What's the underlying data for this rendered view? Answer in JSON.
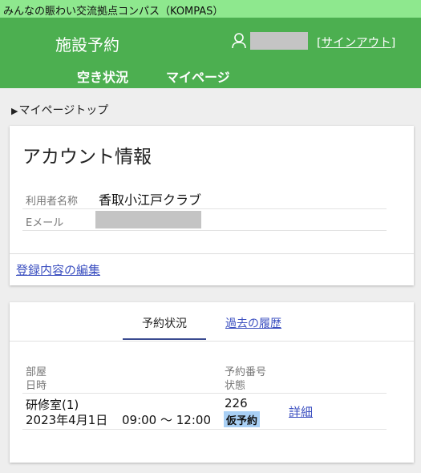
{
  "site": {
    "title": "みんなの賑わい交流拠点コンパス（KOMPAS）"
  },
  "header": {
    "app_title": "施設予約",
    "user_icon": "user-icon",
    "signout_open": "[",
    "signout_label": "サインアウト",
    "signout_close": "]",
    "nav": [
      "空き状況",
      "マイページ"
    ],
    "color": "#4caf50"
  },
  "breadcrumb": {
    "arrow": "▶",
    "label": "マイページトップ"
  },
  "account": {
    "title": "アカウント情報",
    "user_label": "利用者名称",
    "user_value": "香取小江戸クラブ",
    "email_label": "Eメール",
    "edit_link": "登録内容の編集"
  },
  "reservations": {
    "tabs": [
      "予約状況",
      "過去の履歴"
    ],
    "active_tab": 0,
    "headers": {
      "room": "部屋",
      "date": "日時",
      "number": "予約番号",
      "status": "状態"
    },
    "rows": [
      {
        "room": "研修室(1)",
        "date": "2023年4月1日",
        "time": "09:00 ～ 12:00",
        "number": "226",
        "status": "仮予約",
        "detail": "詳細"
      }
    ]
  },
  "colors": {
    "topbar": "#8ee88e",
    "link": "#3b4fc0",
    "badge": "#a9d0f5"
  }
}
